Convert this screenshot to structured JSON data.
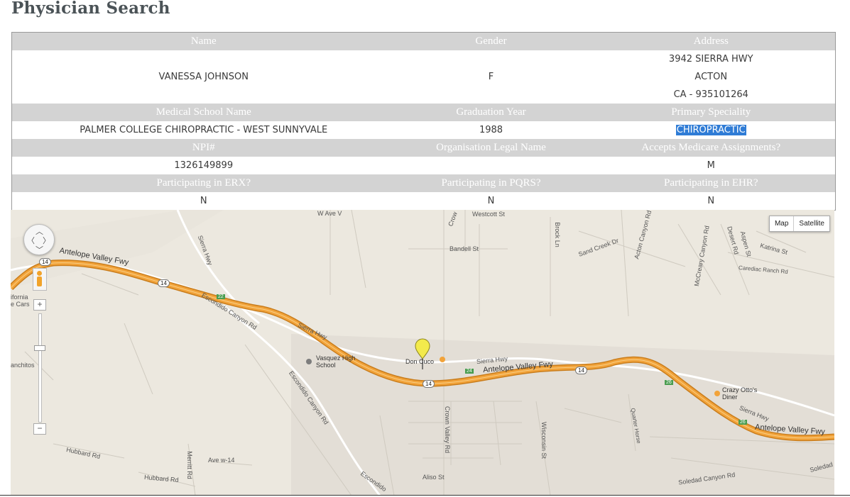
{
  "page": {
    "title": "Physician Search"
  },
  "table": {
    "headers_row1": [
      "Name",
      "Gender",
      "Address"
    ],
    "name": "VANESSA JOHNSON",
    "gender": "F",
    "address": {
      "line1": "3942 SIERRA HWY",
      "line2": "ACTON",
      "line3": "CA - 935101264"
    },
    "headers_row2": [
      "Medical School Name",
      "Graduation Year",
      "Primary Speciality"
    ],
    "medical_school": "PALMER COLLEGE CHIROPRACTIC - WEST SUNNYVALE",
    "graduation_year": "1988",
    "primary_speciality": "CHIROPRACTIC",
    "headers_row3": [
      "NPI#",
      "Organisation Legal Name",
      "Accepts Medicare Assignments?"
    ],
    "npi": "1326149899",
    "org_legal_name": "",
    "accepts_medicare": "M",
    "headers_row4": [
      "Participating in ERX?",
      "Participating in PQRS?",
      "Participating in EHR?"
    ],
    "erx": "N",
    "pqrs": "N",
    "ehr": "N"
  },
  "map": {
    "map_type_buttons": {
      "map": "Map",
      "satellite": "Satellite"
    },
    "zoom_in": "+",
    "zoom_out": "−",
    "road_labels": {
      "antelope_valley_fwy_west": "Antelope Valley Fwy",
      "antelope_valley_fwy_mid": "Antelope Valley Fwy",
      "antelope_valley_fwy_east": "Antelope Valley Fwy",
      "sierra_hwy_nw": "Sierra Hwy",
      "sierra_hwy_mid": "Sierra Hwy",
      "sierra_hwy_center": "Sierra Hwy",
      "sierra_hwy_east": "Sierra Hwy",
      "escondido_canyon_rd_1": "Escondido Canyon Rd",
      "escondido_canyon_rd_2": "Escondido Canyon Rd",
      "escondido_rd_bottom": "Escondido",
      "crown_valley_rd": "Crown Valley Rd",
      "crown_rd_top": "Crow",
      "w_ave_v": "W Ave V",
      "westcott_st": "Westcott St",
      "bandell_st": "Bandell St",
      "brock_ln": "Brock Ln",
      "sand_creek_dr": "Sand Creek Dr",
      "acton_canyon_rd": "Acton Canyon Rd",
      "mccreary_canyon_rd": "McCreary Canyon Rd",
      "desert_rd": "Desert Rd",
      "aspen_st": "Aspen St",
      "katrina_st": "Katrina St",
      "carediac_ranch_rd": "Carediac Ranch Rd",
      "wisconsin_st": "Wisconsin St",
      "quarter_horse": "Quarter Horse",
      "soledad_canyon_rd": "Soledad Canyon Rd",
      "soledad_right": "Soledad",
      "hubbard_rd_1": "Hubbard Rd",
      "hubbard_rd_2": "Hubbard Rd",
      "merritt_rd": "Merritt Rd",
      "ave_w14": "Ave w-14",
      "aliso_st": "Aliso St",
      "california_cars": "ifornia\ne Cars",
      "ranchitos": "anchitos"
    },
    "places": {
      "vasquez_high_school": "Vasquez High School",
      "crazy_ottos": "Crazy Otto's Diner",
      "don_cuco": "Don Cuco"
    },
    "shields": {
      "hwy14_a": "14",
      "hwy14_b": "14",
      "hwy14_c": "14",
      "hwy14_d": "14",
      "exit22": "22",
      "exit24": "24",
      "exit26a": "26",
      "exit26b": "26"
    },
    "colors": {
      "freeway": "#f2a33a",
      "freeway_edge": "#c97d1c",
      "land": "#ece8df",
      "developed": "#e2ddd5"
    }
  }
}
